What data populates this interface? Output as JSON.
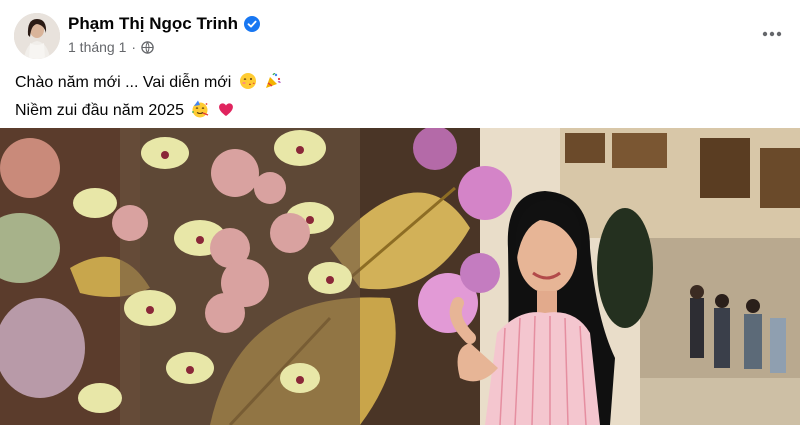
{
  "post": {
    "author": "Phạm Thị Ngọc Trinh",
    "verified": true,
    "timestamp": "1 tháng 1",
    "separator": "·",
    "audience_icon": "globe-icon",
    "more_icon": "more-dots-icon",
    "caption_lines": [
      {
        "text": "Chào năm mới ... Vai diễn mới",
        "emojis": [
          "kissing-face-emoji",
          "party-popper-emoji"
        ]
      },
      {
        "text": "Niềm zui đầu năm 2025",
        "emojis": [
          "partying-face-emoji",
          "red-heart-emoji"
        ]
      }
    ],
    "photo": "woman in pink striped shirt posing beside large flower arrangement with golden leaves",
    "colors": {
      "verified_badge": "#1877f2",
      "name_text": "#050505",
      "meta_text": "#65676b"
    }
  }
}
